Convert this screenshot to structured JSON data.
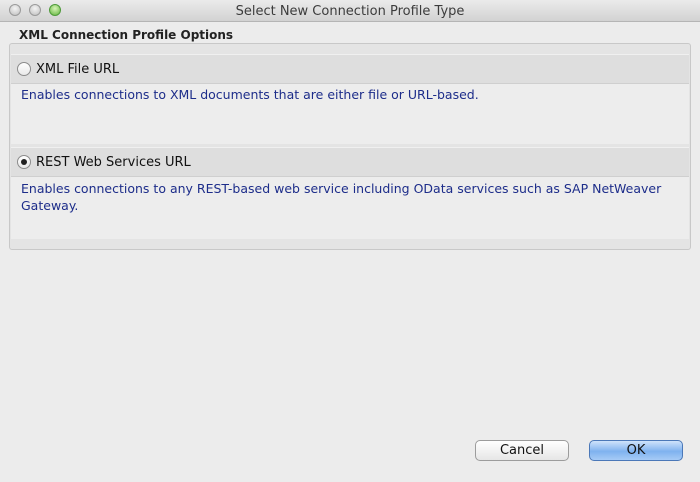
{
  "window": {
    "title": "Select New Connection Profile Type"
  },
  "group": {
    "label": "XML Connection Profile Options"
  },
  "options": [
    {
      "label": "XML File URL",
      "selected": false,
      "description": "Enables connections to XML documents that are either file or URL-based."
    },
    {
      "label": "REST Web Services URL",
      "selected": true,
      "description": "Enables connections to any REST-based web service including OData services such as SAP NetWeaver Gateway."
    }
  ],
  "buttons": {
    "cancel": "Cancel",
    "ok": "OK"
  }
}
